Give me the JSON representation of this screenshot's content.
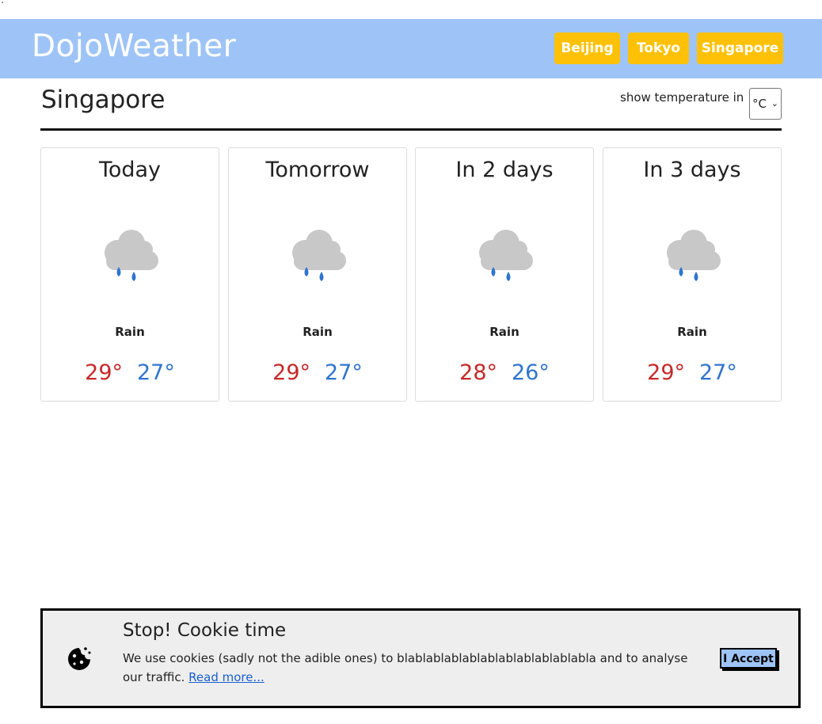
{
  "header": {
    "brand": "DojoWeather",
    "cities": [
      "Beijing",
      "Tokyo",
      "Singapore"
    ],
    "bg_color": "#9ec4f7",
    "button_color": "#ffc107"
  },
  "location": {
    "city": "Singapore",
    "unit_label": "show temperature in",
    "unit_value": "°C"
  },
  "forecast": [
    {
      "day": "Today",
      "condition": "Rain",
      "icon": "rain-cloud-icon",
      "high": "29°",
      "low": "27°"
    },
    {
      "day": "Tomorrow",
      "condition": "Rain",
      "icon": "rain-cloud-icon",
      "high": "29°",
      "low": "27°"
    },
    {
      "day": "In 2 days",
      "condition": "Rain",
      "icon": "rain-cloud-icon",
      "high": "28°",
      "low": "26°"
    },
    {
      "day": "In 3 days",
      "condition": "Rain",
      "icon": "rain-cloud-icon",
      "high": "29°",
      "low": "27°"
    }
  ],
  "colors": {
    "high": "#c62828",
    "low": "#2f74d0"
  },
  "cookie": {
    "title": "Stop! Cookie time",
    "text": "We use cookies (sadly not the adible ones) to blablablablablablablablablablabla and to analyse our traffic.",
    "link": "Read more...",
    "accept": "I Accept",
    "icon": "cookie-icon"
  }
}
